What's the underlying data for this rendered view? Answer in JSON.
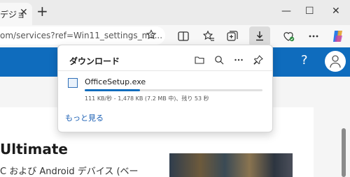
{
  "tab": {
    "title_fragment": "デジョ",
    "close_glyph": "✕"
  },
  "toolbar": {
    "new_tab_glyph": "+",
    "address_text": "om/services?ref=Win11_settings_ms..."
  },
  "window": {
    "minimize_glyph": "—",
    "maximize_glyph": "☐",
    "close_glyph": "✕"
  },
  "download_panel": {
    "title": "ダウンロード",
    "file_name": "OfficeSetup.exe",
    "progress_fraction": 0.31,
    "status": "111 KB/秒 - 1,478 KB (7.2 MB 中)、残り 53 秒",
    "more_link": "もっと見る"
  },
  "page": {
    "help_glyph": "?",
    "heading": "Ultimate",
    "subtitle": "C および Android デバイス (ベー"
  },
  "colors": {
    "accent": "#0f6cbd",
    "page_banner": "#0f6cbd"
  }
}
